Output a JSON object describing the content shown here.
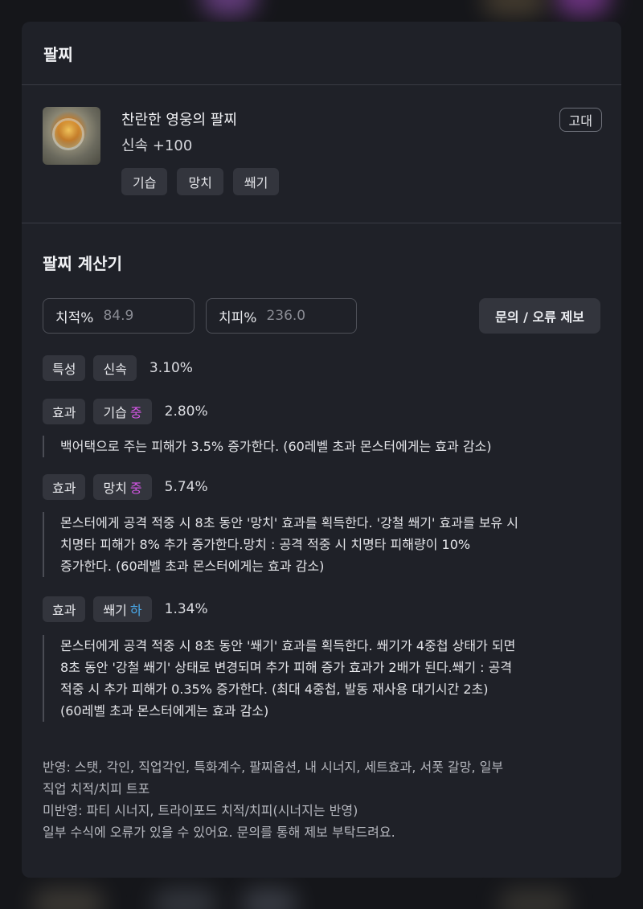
{
  "panel": {
    "title": "팔찌"
  },
  "item": {
    "name": "찬란한 영웅의 팔찌",
    "stat": "신속 +100",
    "grade": "고대",
    "tags": [
      "기습",
      "망치",
      "쐐기"
    ]
  },
  "calculator": {
    "title": "팔찌 계산기",
    "crit_rate_label": "치적%",
    "crit_rate_value": "84.9",
    "crit_dmg_label": "치피%",
    "crit_dmg_value": "236.0",
    "report_button": "문의 / 오류 제보"
  },
  "rows": {
    "trait": {
      "kind": "특성",
      "name": "신속",
      "pct": "3.10%"
    },
    "effect1": {
      "kind": "효과",
      "name": "기습",
      "level": "중",
      "pct": "2.80%",
      "desc": "백어택으로 주는 피해가 3.5% 증가한다. (60레벨 초과 몬스터에게는 효과 감소)"
    },
    "effect2": {
      "kind": "효과",
      "name": "망치",
      "level": "중",
      "pct": "5.74%",
      "desc_lines": [
        "몬스터에게 공격 적중 시 8초 동안 '망치' 효과를 획득한다. '강철 쐐기' 효과를 보유 시",
        "치명타 피해가 8% 추가 증가한다.망치 : 공격 적중 시 치명타 피해량이 10%",
        "증가한다. (60레벨 초과 몬스터에게는 효과 감소)"
      ]
    },
    "effect3": {
      "kind": "효과",
      "name": "쐐기",
      "level": "하",
      "pct": "1.34%",
      "desc_lines": [
        "몬스터에게 공격 적중 시 8초 동안 '쐐기' 효과를 획득한다. 쐐기가 4중첩 상태가 되면",
        "8초 동안 '강철 쐐기' 상태로 변경되며 추가 피해 증가 효과가 2배가 된다.쐐기 : 공격",
        "적중 시 추가 피해가 0.35% 증가한다. (최대 4중첩, 발동 재사용 대기시간 2초)",
        "(60레벨 초과 몬스터에게는 효과 감소)"
      ]
    }
  },
  "notes": [
    "반영: 스탯, 각인, 직업각인, 특화계수, 팔찌옵션, 내 시너지, 세트효과, 서폿 갈망, 일부",
    "직업 치적/치피 트포",
    "미반영: 파티 시너지, 트라이포드 치적/치피(시너지는 반영)",
    "일부 수식에 오류가 있을 수 있어요. 문의를 통해 제보 부탁드려요."
  ],
  "colors": {
    "level_mid": "#d556e6",
    "level_low": "#4aa8e8",
    "panel_bg": "#1f2128"
  }
}
